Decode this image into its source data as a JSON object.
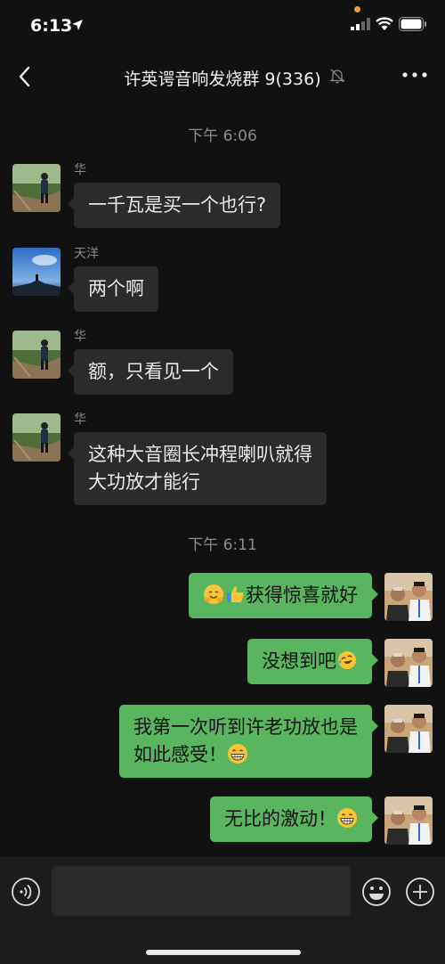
{
  "status": {
    "time": "6:13",
    "colors": {
      "location_dot": "#f0a030"
    }
  },
  "header": {
    "title": "许英谔音响发烧群 9(336)",
    "icons": [
      "back-chevron-icon",
      "mute-bell-icon",
      "more-dots-icon"
    ]
  },
  "chat": {
    "time_markers": [
      "下午 6:06",
      "下午 6:11"
    ],
    "messages": [
      {
        "sender": "华",
        "text": "一千瓦是买一个也行?",
        "direction": "incoming"
      },
      {
        "sender": "天洋",
        "text": "两个啊",
        "direction": "incoming"
      },
      {
        "sender": "华",
        "text": "额，只看见一个",
        "direction": "incoming"
      },
      {
        "sender": "华",
        "text": "这种大音圈长冲程喇叭就得",
        "text2": "大功放才能行",
        "direction": "incoming"
      },
      {
        "text": "获得惊喜就好",
        "emoji_before": [
          "hugging-face-emoji",
          "thumbs-up-emoji"
        ],
        "direction": "outgoing"
      },
      {
        "text": "没想到吧",
        "emoji_after": "laughing-tears-emoji",
        "direction": "outgoing"
      },
      {
        "text": "我第一次听到许老功放也是",
        "text2": "如此感受！",
        "emoji_after": "grinning-face-emoji",
        "direction": "outgoing"
      },
      {
        "text": "无比的激动！",
        "emoji_after": "grinning-face-emoji",
        "direction": "outgoing"
      }
    ]
  },
  "input_bar": {
    "value": "",
    "icons": [
      "voice-icon",
      "emoji-face-icon",
      "plus-icon"
    ]
  },
  "colors": {
    "background": "#111111",
    "incoming_bubble": "#2b2b2b",
    "outgoing_bubble": "#59b65f",
    "input_bar": "#1c1c1c"
  }
}
